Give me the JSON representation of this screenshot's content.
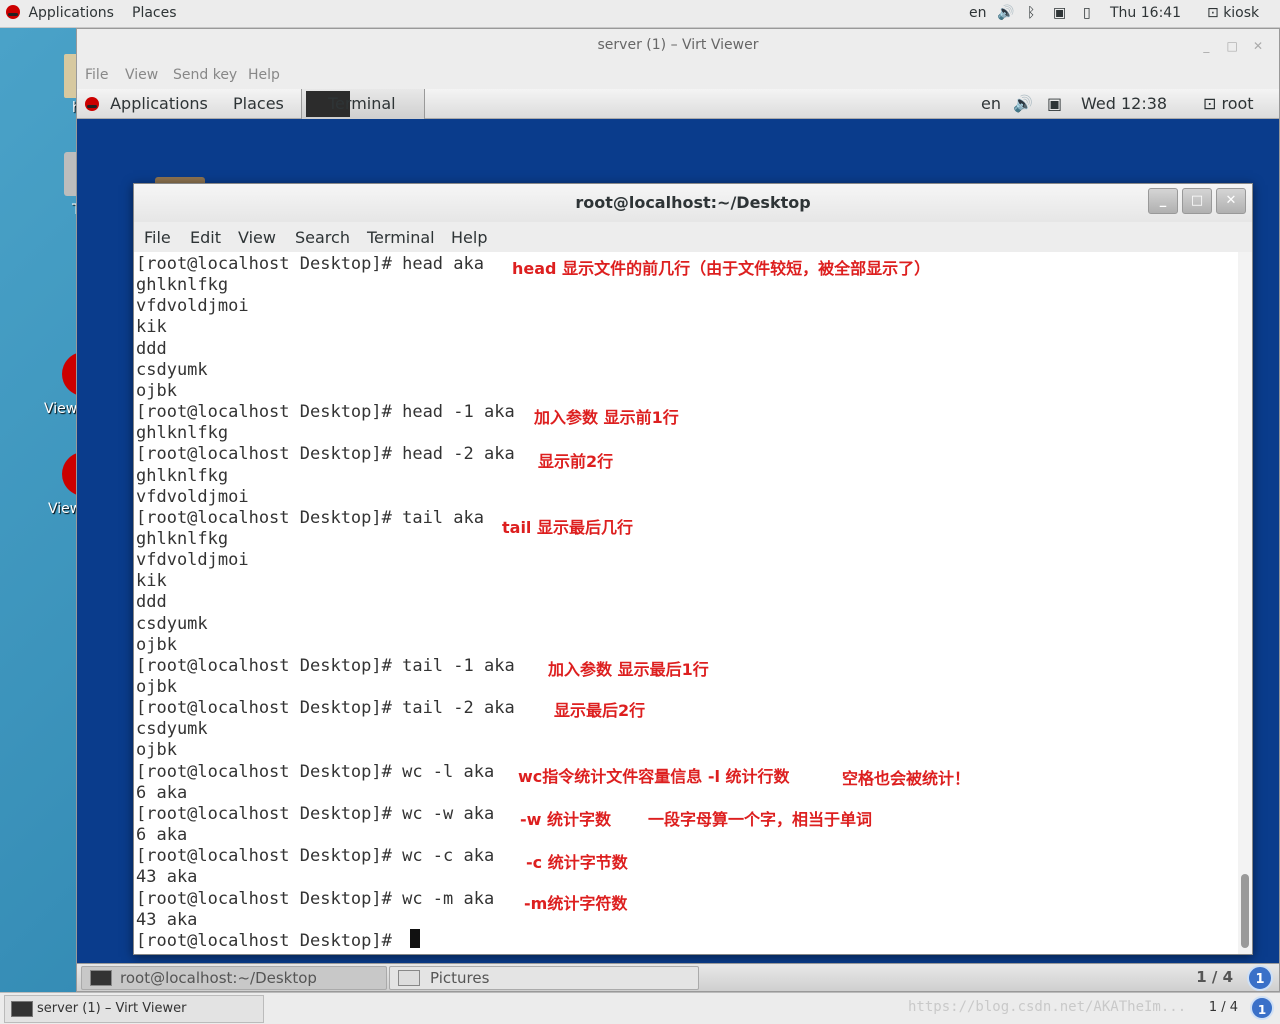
{
  "host": {
    "topbar": {
      "applications": "Applications",
      "places": "Places",
      "lang": "en",
      "clock": "Thu 16:41",
      "user": "kiosk"
    },
    "desktop_labels": [
      "h",
      "T",
      "View",
      "View"
    ],
    "taskbar": {
      "window_label": "server (1) – Virt Viewer",
      "watermark": "https://blog.csdn.net/AKATheIm...",
      "pager": "1 / 4",
      "pager_icon": "1"
    }
  },
  "viewer": {
    "title": "server (1) – Virt Viewer",
    "menu": [
      "File",
      "View",
      "Send key",
      "Help"
    ]
  },
  "guest": {
    "topbar": {
      "applications": "Applications",
      "places": "Places",
      "terminal": "Terminal",
      "lang": "en",
      "clock": "Wed 12:38",
      "user": "root"
    },
    "terminal": {
      "title": "root@localhost:~/Desktop",
      "menu": [
        "File",
        "Edit",
        "View",
        "Search",
        "Terminal",
        "Help"
      ],
      "lines": [
        "[root@localhost Desktop]# head aka",
        "ghlknlfkg",
        "vfdvoldjmoi",
        "kik",
        "ddd",
        "csdyumk",
        "ojbk",
        "[root@localhost Desktop]# head -1 aka",
        "ghlknlfkg",
        "[root@localhost Desktop]# head -2 aka",
        "ghlknlfkg",
        "vfdvoldjmoi",
        "[root@localhost Desktop]# tail aka",
        "ghlknlfkg",
        "vfdvoldjmoi",
        "kik",
        "ddd",
        "csdyumk",
        "ojbk",
        "[root@localhost Desktop]# tail -1 aka",
        "ojbk",
        "[root@localhost Desktop]# tail -2 aka",
        "csdyumk",
        "ojbk",
        "[root@localhost Desktop]# wc -l aka",
        "6 aka",
        "[root@localhost Desktop]# wc -w aka",
        "6 aka",
        "[root@localhost Desktop]# wc -c aka",
        "43 aka",
        "[root@localhost Desktop]# wc -m aka",
        "43 aka",
        "[root@localhost Desktop]# "
      ],
      "notes": [
        "head 显示文件的前几行（由于文件较短，被全部显示了）",
        "加入参数 显示前1行",
        "显示前2行",
        "tail 显示最后几行",
        "加入参数 显示最后1行",
        "显示最后2行",
        "wc指令统计文件容量信息 -l 统计行数",
        "空格也会被统计！",
        "-w 统计字数",
        "一段字母算一个字，相当于单词",
        "-c 统计字节数",
        "-m统计字符数"
      ]
    },
    "taskbar": {
      "task1": "root@localhost:~/Desktop",
      "task2": "Pictures",
      "pager": "1 / 4",
      "pager_icon": "1"
    }
  }
}
